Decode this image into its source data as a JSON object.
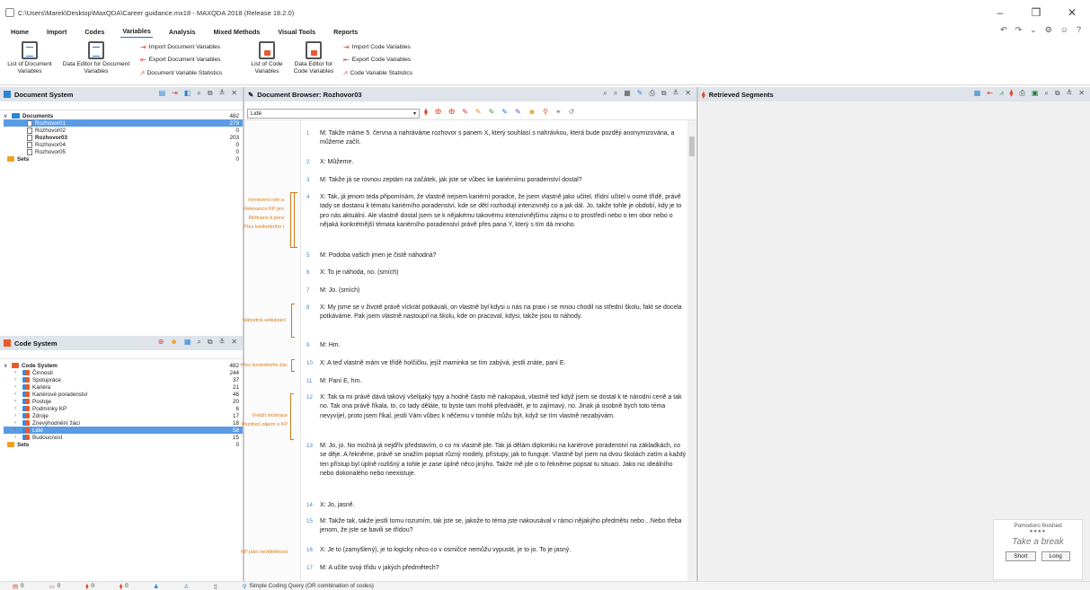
{
  "window": {
    "title": "C:\\Users\\Marek\\Desktop\\MaxQDA\\Career guidance.mx18 - MAXQDA 2018 (Release 18.2.0)",
    "controls": [
      "–",
      "❐",
      "✕"
    ]
  },
  "menu": [
    "Home",
    "Import",
    "Codes",
    "Variables",
    "Analysis",
    "Mixed Methods",
    "Visual Tools",
    "Reports"
  ],
  "menu_active": "Variables",
  "ribbon": {
    "list_doc_vars": "List of Document Variables",
    "data_editor_doc": "Data Editor for Document Variables",
    "import_doc_vars": "Import Document Variables",
    "export_doc_vars": "Export Document Variables",
    "doc_var_stats": "Document Variable Statistics",
    "list_code_vars": "List of Code Variables",
    "data_editor_code": "Data Editor for Code Variables",
    "import_code_vars": "Import Code Variables",
    "export_code_vars": "Export Code Variables",
    "code_var_stats": "Code Variable Statistics"
  },
  "document_system": {
    "title": "Document System",
    "items": [
      {
        "label": "Documents",
        "count": "482"
      },
      {
        "label": "Rozhovor01",
        "count": "279"
      },
      {
        "label": "Rozhovor02",
        "count": "0"
      },
      {
        "label": "Rozhovor03",
        "count": "203"
      },
      {
        "label": "Rozhovor04",
        "count": "0"
      },
      {
        "label": "Rozhovor05",
        "count": "0"
      },
      {
        "label": "Sets",
        "count": "0"
      }
    ]
  },
  "code_system": {
    "title": "Code System",
    "items": [
      {
        "label": "Code System",
        "count": "482"
      },
      {
        "label": "Činnosti",
        "count": "244"
      },
      {
        "label": "Spolupráce",
        "count": "37"
      },
      {
        "label": "Kariéra",
        "count": "21"
      },
      {
        "label": "Kariérové poradenství",
        "count": "46"
      },
      {
        "label": "Postoje",
        "count": "20"
      },
      {
        "label": "Podmínky KP",
        "count": "6"
      },
      {
        "label": "Zdroje",
        "count": "17"
      },
      {
        "label": "Znevýhodnění žáci",
        "count": "18"
      },
      {
        "label": "Lidé",
        "count": "58"
      },
      {
        "label": "Budoucnost",
        "count": "15"
      },
      {
        "label": "Sets",
        "count": "0"
      }
    ]
  },
  "document_browser": {
    "title": "Document Browser: Rozhovor03",
    "filter": "Lidé"
  },
  "margin_codes": [
    "Vymezení role a",
    "Relevance KP pro",
    "Motivace k pora",
    "Přes konkrétního i",
    "Náhodná setkávání",
    "Přes konkrétního žác",
    "Vnější motivace",
    "Pozitivní zájem o KP",
    "KP jako neviditelnost"
  ],
  "paragraphs": [
    {
      "n": "1",
      "text": "M: Takže máme 5. června a nahráváme rozhovor s panem X, který souhlasí s nahrávkou, která bude později anonymizována, a můžeme začít."
    },
    {
      "n": "2",
      "text": "X: Můžeme."
    },
    {
      "n": "3",
      "text": "M: Takže já se rovnou zeptám na začátek, jak jste se vůbec ke kariérnímu poradenství dostal?"
    },
    {
      "n": "4",
      "text": "X: Tak, já jenom teda připomínám, že vlastně nejsem kariérní poradce, že jsem vlastně jako učitel, třídní učitel v osmé třídě, právě tady se dostanu k tématu kariérního poradenství, kde se dětí rozhodují intenzivněji co a jak dál. Jo, takže tohle je období, kdy je to pro nás aktuální. Ale vlastně dostal jsem se k nějakému takovému intenzivnějšímu zájmu o to prostředí nebo o ten obor nebo o nějaká konkrétnější témata kariérního poradenství právě přes pana Y, který s tím dá mnoho."
    },
    {
      "n": "5",
      "text": "M: Podoba vašich jmen je čistě náhodná?"
    },
    {
      "n": "6",
      "text": "X: To je náhoda, no. (smích)"
    },
    {
      "n": "7",
      "text": "M: Jo. (smích)"
    },
    {
      "n": "8",
      "text": "X: My jsme se v životě právě víckrát potkávali, on vlastně byl kdysi u nás na praxi i se mnou chodil na střední školu, fakt se docela potkáváme. Pak jsem vlastně nastoupil na školu, kde on pracoval, kdysi, takže jsou to náhody."
    },
    {
      "n": "9",
      "text": "M: Hm."
    },
    {
      "n": "10",
      "text": "X: A teď vlastně mám ve třídě holčičku, jejíž maminka se tím zabývá, jestli znáte, paní E."
    },
    {
      "n": "11",
      "text": "M: Paní E, hm."
    },
    {
      "n": "12",
      "text": "X: Tak ta mi právě dává takový všelijaký typy a hodně často mě nakopává, vlastně teď když jsem se dostal k té národní ceně a tak no. Tak ona právě říkala, to, co tady děláte, to byste tam mohli předvádět, je to zajímavý, no. Jinak já osobně bych toto téma nevyvíjel, proto jsem říkal, jestli Vám vůbec k něčemu v tomhle můžu být, když se tím vlastně nezabývám."
    },
    {
      "n": "13",
      "text": "M: Jo, jo. No možná já nejdřív představím, o co mi vlastně jde. Tak já dělám diplomku na kariérové poradenství na základkách, co se děje. A řekněme, právě se snažím popsat různý modely, přístupy, jak to funguje. Vlastně byl jsem na dvou školách zatím a každý ten přístup byl úplně rozlišný a tohle je zase úplně něco jinýho. Takže mě jde o to řekněme popsat tu situaci. Jako nic ideálního nebo dokonalého nebo neexistuje."
    },
    {
      "n": "14",
      "text": "X: Jo, jasně."
    },
    {
      "n": "15",
      "text": "M: Takže tak, takže jestli tomu rozumím, tak jste se, jakože to téma jste nakousával v rámci nějakýho předmětu nebo…Nebo třeba jenom, že jste se bavili se třídou?"
    },
    {
      "n": "16",
      "text": "X: Je to (zamyšlený), je to logicky něco co v osmičce nemůžu vypustit, je to jo. To je jasný."
    },
    {
      "n": "17",
      "text": "M:  A učíte svoji třídu v jakých předmětech?"
    }
  ],
  "retrieved_segments": {
    "title": "Retrieved Segments"
  },
  "pomodoro": {
    "status": "Pomodoro finished",
    "dots": "●●●●",
    "message": "Take a break",
    "short": "Short",
    "long": "Long"
  },
  "statusbar": {
    "c1": "0",
    "c2": "0",
    "c3": "0",
    "c4": "0",
    "query": "Simple Coding Query (OR combination of codes)"
  }
}
